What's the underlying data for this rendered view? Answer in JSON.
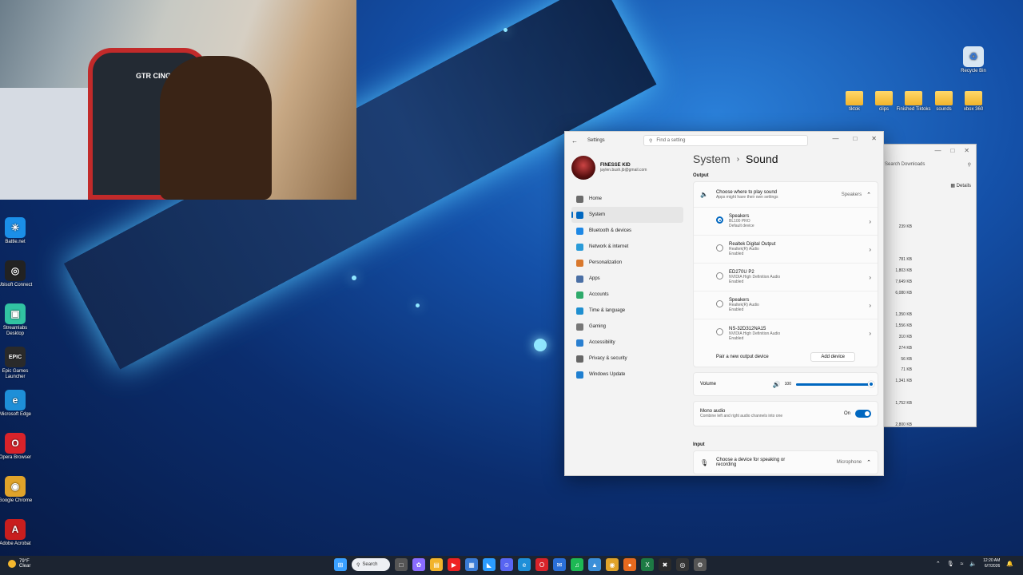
{
  "webcam": {
    "chair_brand": "GTR CING"
  },
  "desktop_icons_left": [
    {
      "label": "Battle.net",
      "glyph": "✳",
      "color": "#1b8fe8"
    },
    {
      "label": "Ubisoft Connect",
      "glyph": "◎",
      "color": "#222"
    },
    {
      "label": "Streamlabs Desktop",
      "glyph": "▣",
      "color": "#31c3a2"
    },
    {
      "label": "Epic Games Launcher",
      "glyph": "EPIC",
      "color": "#2a2a2a"
    },
    {
      "label": "Microsoft Edge",
      "glyph": "e",
      "color": "#1e8fd8"
    },
    {
      "label": "Opera Browser",
      "glyph": "O",
      "color": "#d8232a"
    },
    {
      "label": "Google Chrome",
      "glyph": "◉",
      "color": "#e0a32a"
    },
    {
      "label": "Adobe Acrobat",
      "glyph": "A",
      "color": "#c81e1e"
    }
  ],
  "desktop_icons_right": [
    {
      "label": "Recycle Bin"
    },
    {
      "label": "tiktok"
    },
    {
      "label": "clips"
    },
    {
      "label": "Finished Tiktoks"
    },
    {
      "label": "sounds"
    },
    {
      "label": "xbox 360"
    }
  ],
  "explorer": {
    "search_placeholder": "Search Downloads",
    "details_label": "Details",
    "sizes": [
      "239 KB",
      "",
      "",
      "781 KB",
      "1,803 KB",
      "7,649 KB",
      "6,080 KB",
      "",
      "1,350 KB",
      "1,556 KB",
      "310 KB",
      "274 KB",
      "56 KB",
      "71 KB",
      "1,341 KB",
      "",
      "1,752 KB",
      "",
      "2,800 KB"
    ]
  },
  "settings": {
    "app_title": "Settings",
    "search_placeholder": "Find a setting",
    "profile": {
      "name": "FINESSE KID",
      "email": "jaylen.bush.jb@gmail.com"
    },
    "nav": [
      {
        "label": "Home",
        "color": "#6b6b6b",
        "active": false
      },
      {
        "label": "System",
        "color": "#0067c0",
        "active": true
      },
      {
        "label": "Bluetooth & devices",
        "color": "#1e88e5",
        "active": false
      },
      {
        "label": "Network & internet",
        "color": "#2a9bd8",
        "active": false
      },
      {
        "label": "Personalization",
        "color": "#d9782d",
        "active": false
      },
      {
        "label": "Apps",
        "color": "#4a6fa5",
        "active": false
      },
      {
        "label": "Accounts",
        "color": "#2eaa6b",
        "active": false
      },
      {
        "label": "Time & language",
        "color": "#1f8fd0",
        "active": false
      },
      {
        "label": "Gaming",
        "color": "#777",
        "active": false
      },
      {
        "label": "Accessibility",
        "color": "#2a7fd0",
        "active": false
      },
      {
        "label": "Privacy & security",
        "color": "#666",
        "active": false
      },
      {
        "label": "Windows Update",
        "color": "#1f7fd0",
        "active": false
      }
    ],
    "breadcrumb": {
      "parent": "System",
      "current": "Sound"
    },
    "output_label": "Output",
    "choose_output": {
      "title": "Choose where to play sound",
      "subtitle": "Apps might have their own settings",
      "value": "Speakers"
    },
    "devices": [
      {
        "name": "Speakers",
        "line2": "BL100 PRO",
        "line3": "Default device",
        "selected": true
      },
      {
        "name": "Realtek Digital Output",
        "line2": "Realtek(R) Audio",
        "line3": "Enabled",
        "selected": false
      },
      {
        "name": "ED270U P2",
        "line2": "NVIDIA High Definition Audio",
        "line3": "Enabled",
        "selected": false
      },
      {
        "name": "Speakers",
        "line2": "Realtek(R) Audio",
        "line3": "Enabled",
        "selected": false
      },
      {
        "name": "NS-32D312NA15",
        "line2": "NVIDIA High Definition Audio",
        "line3": "Enabled",
        "selected": false
      }
    ],
    "pair_new": {
      "label": "Pair a new output device",
      "button": "Add device"
    },
    "volume": {
      "label": "Volume",
      "value": "100",
      "level": 1.0
    },
    "mono": {
      "title": "Mono audio",
      "subtitle": "Combine left and right audio channels into one",
      "state": "On"
    },
    "input_label": "Input",
    "choose_input": {
      "title": "Choose a device for speaking or recording",
      "value": "Microphone"
    }
  },
  "taskbar": {
    "weather_temp": "79°F",
    "weather_cond": "Clear",
    "search_label": "Search",
    "apps": [
      {
        "name": "windows-start",
        "glyph": "⊞",
        "color": "#3aa0ff"
      },
      {
        "name": "task-view",
        "glyph": "□",
        "color": "#555"
      },
      {
        "name": "copilot",
        "glyph": "✿",
        "color": "#8a6cff"
      },
      {
        "name": "file-explorer",
        "glyph": "▤",
        "color": "#f2b42b"
      },
      {
        "name": "youtube",
        "glyph": "▶",
        "color": "#e22"
      },
      {
        "name": "store",
        "glyph": "▦",
        "color": "#3a7bd5"
      },
      {
        "name": "clipchamp",
        "glyph": "◣",
        "color": "#2b9cff"
      },
      {
        "name": "discord",
        "glyph": "☺",
        "color": "#5865f2"
      },
      {
        "name": "edge",
        "glyph": "e",
        "color": "#1e8fd8"
      },
      {
        "name": "opera",
        "glyph": "O",
        "color": "#d8232a"
      },
      {
        "name": "mail",
        "glyph": "✉",
        "color": "#2a6fd8"
      },
      {
        "name": "spotify",
        "glyph": "♫",
        "color": "#1db954"
      },
      {
        "name": "photos",
        "glyph": "▲",
        "color": "#3b8fd8"
      },
      {
        "name": "chrome",
        "glyph": "◉",
        "color": "#e0a32a"
      },
      {
        "name": "firefox",
        "glyph": "●",
        "color": "#e66a1f"
      },
      {
        "name": "excel",
        "glyph": "X",
        "color": "#1d7a44"
      },
      {
        "name": "xbox",
        "glyph": "✖",
        "color": "#2a2a2a"
      },
      {
        "name": "obs",
        "glyph": "◎",
        "color": "#333"
      },
      {
        "name": "settings",
        "glyph": "⚙",
        "color": "#555"
      }
    ],
    "time": "12:20 AM",
    "date": "6/7/2026"
  }
}
